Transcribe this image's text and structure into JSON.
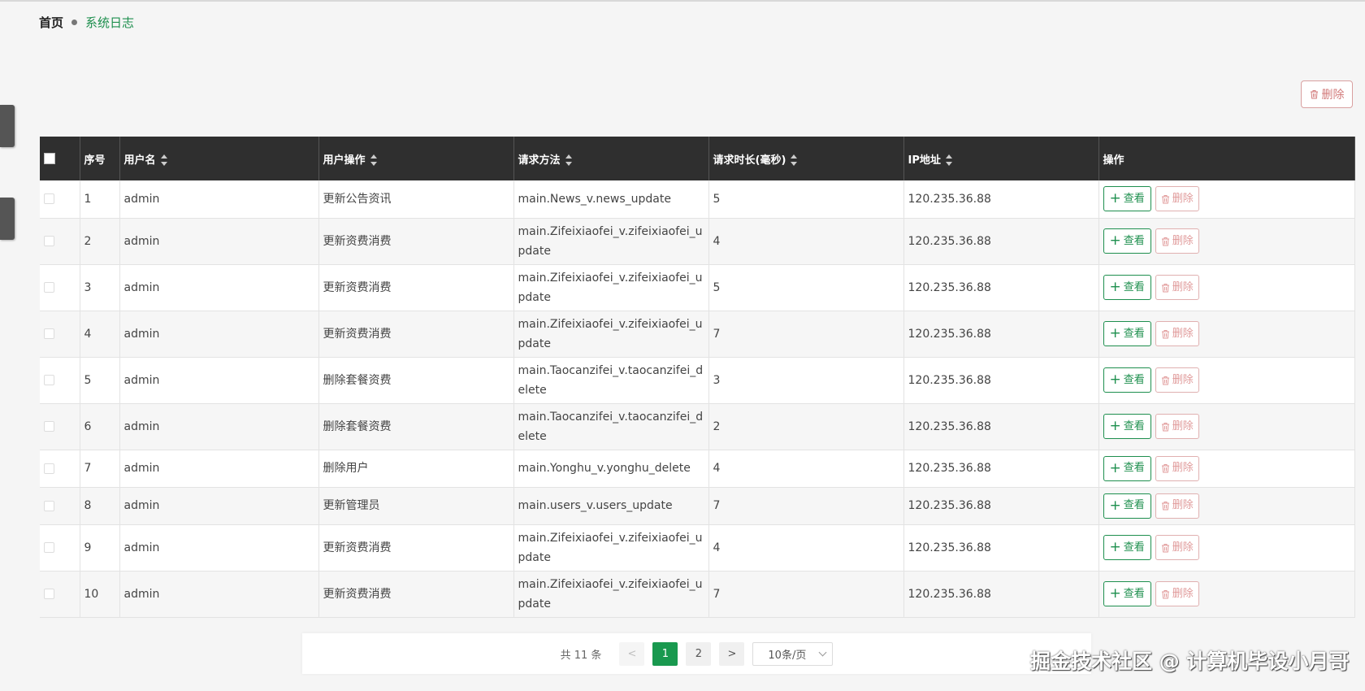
{
  "breadcrumb": {
    "home": "首页",
    "current": "系统日志"
  },
  "toolbar": {
    "delete_label": "删除"
  },
  "table": {
    "headers": {
      "index": "序号",
      "username": "用户名",
      "operation": "用户操作",
      "method": "请求方法",
      "duration": "请求时长(毫秒)",
      "ip": "IP地址",
      "actions": "操作"
    },
    "rows": [
      {
        "index": "1",
        "username": "admin",
        "operation": "更新公告资讯",
        "method": "main.News_v.news_update",
        "duration": "5",
        "ip": "120.235.36.88"
      },
      {
        "index": "2",
        "username": "admin",
        "operation": "更新资费消费",
        "method": "main.Zifeixiaofei_v.zifeixiaofei_update",
        "duration": "4",
        "ip": "120.235.36.88"
      },
      {
        "index": "3",
        "username": "admin",
        "operation": "更新资费消费",
        "method": "main.Zifeixiaofei_v.zifeixiaofei_update",
        "duration": "5",
        "ip": "120.235.36.88"
      },
      {
        "index": "4",
        "username": "admin",
        "operation": "更新资费消费",
        "method": "main.Zifeixiaofei_v.zifeixiaofei_update",
        "duration": "7",
        "ip": "120.235.36.88"
      },
      {
        "index": "5",
        "username": "admin",
        "operation": "删除套餐资费",
        "method": "main.Taocanzifei_v.taocanzifei_delete",
        "duration": "3",
        "ip": "120.235.36.88"
      },
      {
        "index": "6",
        "username": "admin",
        "operation": "删除套餐资费",
        "method": "main.Taocanzifei_v.taocanzifei_delete",
        "duration": "2",
        "ip": "120.235.36.88"
      },
      {
        "index": "7",
        "username": "admin",
        "operation": "删除用户",
        "method": "main.Yonghu_v.yonghu_delete",
        "duration": "4",
        "ip": "120.235.36.88"
      },
      {
        "index": "8",
        "username": "admin",
        "operation": "更新管理员",
        "method": "main.users_v.users_update",
        "duration": "7",
        "ip": "120.235.36.88"
      },
      {
        "index": "9",
        "username": "admin",
        "operation": "更新资费消费",
        "method": "main.Zifeixiaofei_v.zifeixiaofei_update",
        "duration": "4",
        "ip": "120.235.36.88"
      },
      {
        "index": "10",
        "username": "admin",
        "operation": "更新资费消费",
        "method": "main.Zifeixiaofei_v.zifeixiaofei_update",
        "duration": "7",
        "ip": "120.235.36.88"
      }
    ],
    "view_label": "查看",
    "row_delete_label": "删除"
  },
  "pagination": {
    "total_text": "共 11 条",
    "prev": "<",
    "next": ">",
    "pages": [
      "1",
      "2"
    ],
    "current_page": "1",
    "page_size": "10条/页"
  },
  "watermark": "掘金技术社区 @ 计算机毕设小月哥",
  "colors": {
    "accent": "#1e8f4e",
    "header_bg": "#2f2f2f",
    "danger": "#d27a7a",
    "active_page": "#19994f"
  }
}
